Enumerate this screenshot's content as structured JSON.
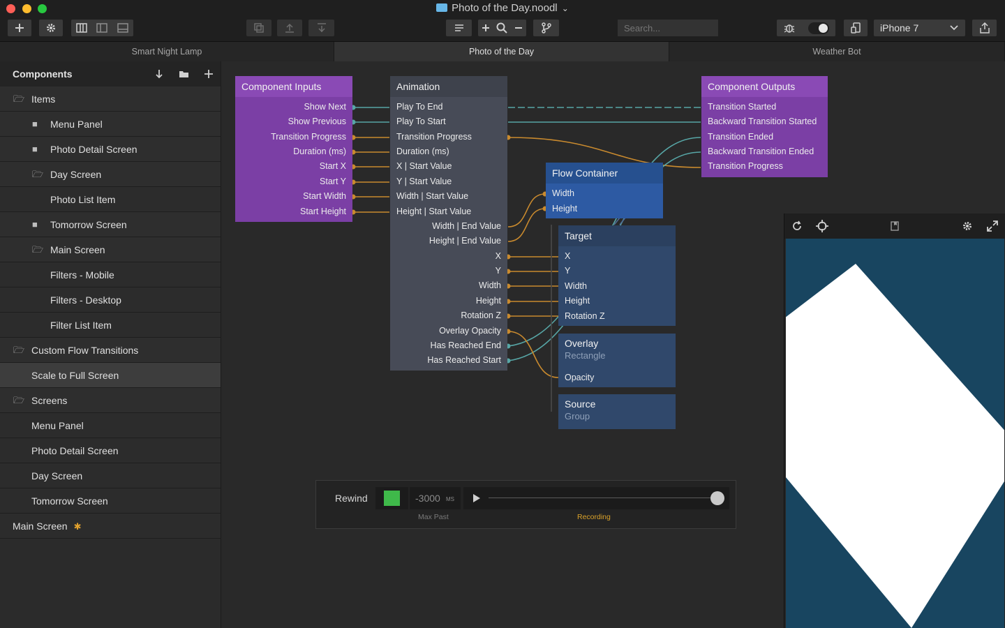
{
  "window": {
    "title": "Photo of the Day.noodl",
    "title_chevron": "⌄"
  },
  "toolbar": {
    "search_placeholder": "Search...",
    "device_label": "iPhone 7"
  },
  "tabs": [
    {
      "label": "Smart Night Lamp",
      "active": false
    },
    {
      "label": "Photo of the Day",
      "active": true
    },
    {
      "label": "Weather Bot",
      "active": false
    }
  ],
  "sidebar": {
    "header": "Components",
    "items": [
      {
        "label": "Items"
      },
      {
        "label": "Menu Panel"
      },
      {
        "label": "Photo Detail Screen"
      },
      {
        "label": "Day Screen"
      },
      {
        "label": "Photo List Item"
      },
      {
        "label": "Tomorrow Screen"
      },
      {
        "label": "Main Screen"
      },
      {
        "label": "Filters - Mobile"
      },
      {
        "label": "Filters - Desktop"
      },
      {
        "label": "Filter List Item"
      },
      {
        "label": "Custom Flow Transitions"
      },
      {
        "label": "Scale to Full Screen"
      },
      {
        "label": "Screens"
      },
      {
        "label": "Menu Panel"
      },
      {
        "label": "Photo Detail Screen"
      },
      {
        "label": "Day Screen"
      },
      {
        "label": "Tomorrow Screen"
      },
      {
        "label": "Main Screen"
      }
    ]
  },
  "nodes": {
    "inputs": {
      "title": "Component Inputs",
      "ports": [
        "Show Next",
        "Show Previous",
        "Transition Progress",
        "Duration (ms)",
        "Start X",
        "Start Y",
        "Start Width",
        "Start Height"
      ]
    },
    "animation": {
      "title": "Animation",
      "inputs": [
        "Play To End",
        "Play To Start",
        "Transition Progress",
        "Duration (ms)",
        "X | Start Value",
        "Y | Start Value",
        "Width | Start Value",
        "Height | Start Value"
      ],
      "outputs": [
        "Width | End Value",
        "Height | End Value",
        "X",
        "Y",
        "Width",
        "Height",
        "Rotation Z",
        "Overlay Opacity",
        "Has Reached End",
        "Has Reached Start"
      ]
    },
    "outputs": {
      "title": "Component Outputs",
      "ports": [
        "Transition Started",
        "Backward Transition Started",
        "Transition Ended",
        "Backward Transition Ended",
        "Transition Progress"
      ]
    },
    "flow": {
      "title": "Flow Container",
      "ports": [
        "Width",
        "Height"
      ]
    },
    "target": {
      "title": "Target",
      "ports": [
        "X",
        "Y",
        "Width",
        "Height",
        "Rotation Z"
      ]
    },
    "overlay": {
      "title": "Overlay",
      "subtitle": "Rectangle",
      "ports": [
        "Opacity"
      ]
    },
    "source": {
      "title": "Source",
      "subtitle": "Group"
    }
  },
  "timeline": {
    "rewind_label": "Rewind",
    "time_value": "-3000",
    "time_unit": "MS",
    "max_past_label": "Max Past",
    "recording_label": "Recording"
  },
  "colors": {
    "inputs_node": "#7b3fa5",
    "outputs_node": "#7b3fa5",
    "animation_node": "#474b57",
    "flow_node": "#2d5aa3",
    "target_node": "#30486b",
    "wire_teal": "#57a6a6",
    "wire_orange": "#c98a2e",
    "record_green": "#3fb94a",
    "recording_text": "#d9a12a",
    "preview_bg": "#184560"
  }
}
